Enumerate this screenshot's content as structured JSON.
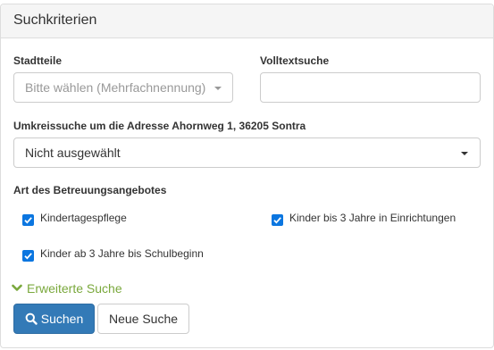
{
  "panel": {
    "title": "Suchkriterien"
  },
  "stadtteile": {
    "label": "Stadtteile",
    "placeholder": "Bitte wählen (Mehrfachnennung)"
  },
  "volltext": {
    "label": "Volltextsuche",
    "value": ""
  },
  "umkreis": {
    "label": "Umkreissuche um die Adresse Ahornweg 1, 36205 Sontra",
    "selected": "Nicht ausgewählt"
  },
  "betreuung": {
    "label": "Art des Betreuungsangebotes",
    "options": [
      {
        "label": "Kindertagespflege",
        "checked": true
      },
      {
        "label": "Kinder bis 3 Jahre in Einrichtungen",
        "checked": true
      },
      {
        "label": "Kinder ab 3 Jahre bis Schulbeginn",
        "checked": true
      }
    ]
  },
  "advanced": {
    "label": "Erweiterte Suche"
  },
  "buttons": {
    "search": "Suchen",
    "reset": "Neue Suche"
  },
  "colors": {
    "primary": "#337ab7",
    "checkbox": "#0b76e0",
    "link": "#7aa83c"
  }
}
